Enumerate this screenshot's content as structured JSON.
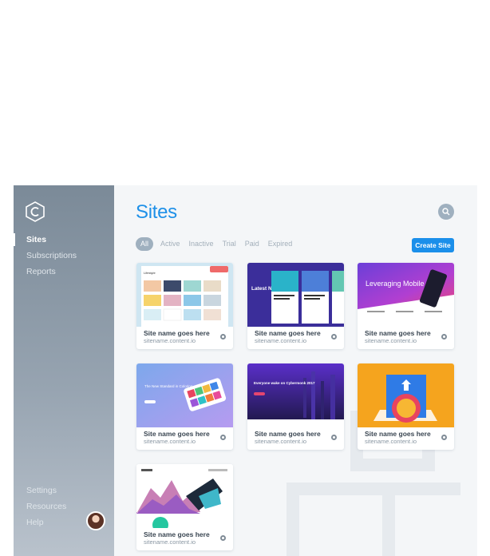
{
  "app": {
    "nav": [
      {
        "label": "Sites"
      },
      {
        "label": "Subscriptions"
      },
      {
        "label": "Reports"
      }
    ],
    "nav_bottom": [
      {
        "label": "Settings"
      },
      {
        "label": "Resources"
      },
      {
        "label": "Help"
      }
    ]
  },
  "main": {
    "title": "Sites",
    "filters": [
      "All",
      "Active",
      "Inactive",
      "Trial",
      "Paid",
      "Expired"
    ],
    "create_label": "Create Site"
  },
  "sites": [
    {
      "name": "Site name goes here",
      "url": "sitename.content.io",
      "thumb_text": "Lifestyle"
    },
    {
      "name": "Site name goes here",
      "url": "sitename.content.io",
      "thumb_text": "Latest News"
    },
    {
      "name": "Site name goes here",
      "url": "sitename.content.io",
      "thumb_text": "Leveraging Mobile"
    },
    {
      "name": "Site name goes here",
      "url": "sitename.content.io",
      "thumb_text": "The New Standard in Coloring"
    },
    {
      "name": "Site name goes here",
      "url": "sitename.content.io",
      "thumb_text": "Everyone wake on Cybermonk 2017"
    },
    {
      "name": "Site name goes here",
      "url": "sitename.content.io",
      "thumb_text": ""
    },
    {
      "name": "Site name goes here",
      "url": "sitename.content.io",
      "thumb_text": ""
    }
  ],
  "icons": {
    "logo": "c-logo-icon",
    "search": "search-icon",
    "settings": "gear-icon"
  },
  "colors": {
    "accent": "#1b8fea",
    "sidebar": "#8796a4",
    "title": "#1e90e8"
  }
}
